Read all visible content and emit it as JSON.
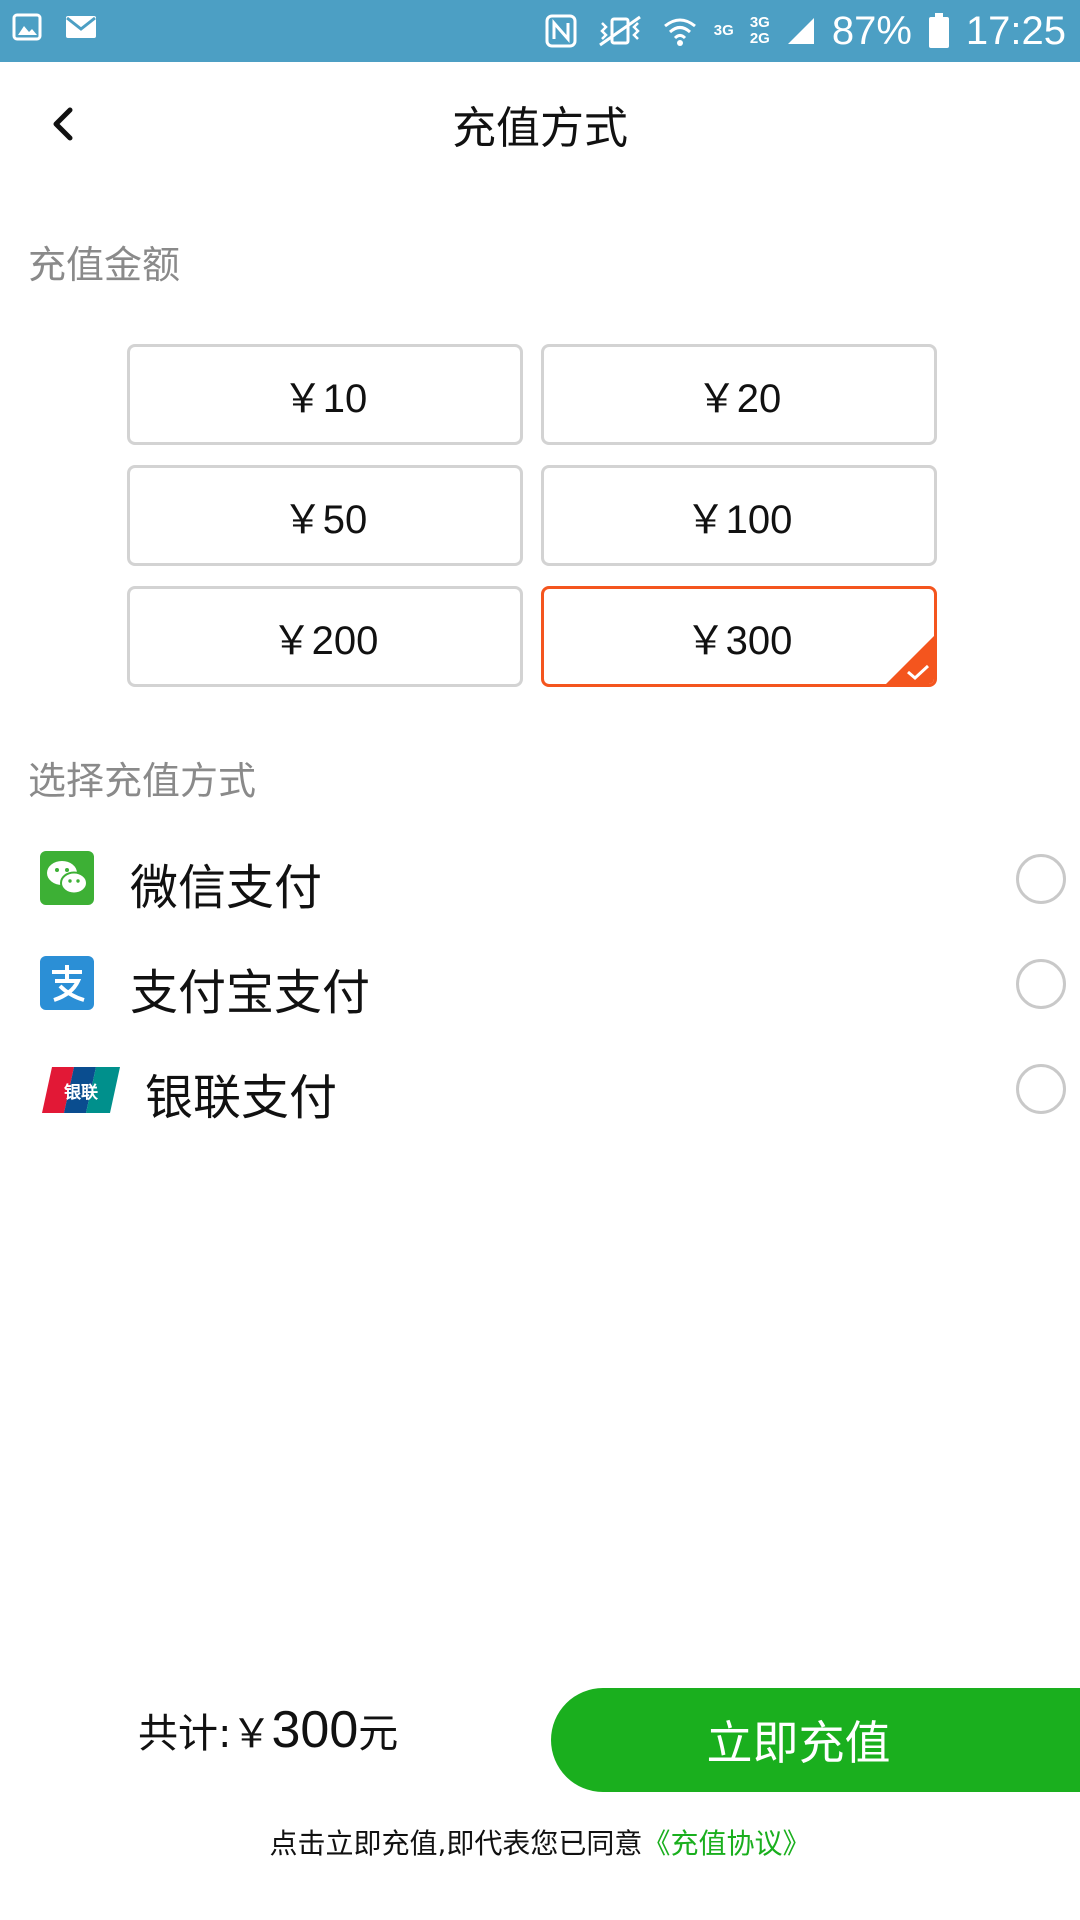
{
  "status_bar": {
    "battery": "87%",
    "time": "17:25",
    "net1": "3G",
    "net2_top": "3G",
    "net2_bottom": "2G",
    "colors": {
      "background": "#4c9fc4"
    }
  },
  "header": {
    "title": "充值方式",
    "back_icon": "chevron-left-icon"
  },
  "amount_section": {
    "label": "充值金额",
    "options": [
      "￥10",
      "￥20",
      "￥50",
      "￥100",
      "￥200",
      "￥300"
    ],
    "selected": "￥300",
    "colors": {
      "selected_border": "#f4551e",
      "border": "#d3d3d3"
    }
  },
  "method_section": {
    "label": "选择充值方式",
    "methods": [
      {
        "label": "微信支付",
        "icon": "wechat-icon"
      },
      {
        "label": "支付宝支付",
        "icon": "alipay-icon"
      },
      {
        "label": "银联支付",
        "icon": "unionpay-icon",
        "icon_text": "银联"
      }
    ]
  },
  "footer": {
    "total_prefix": "共计:￥",
    "total_amount": "300",
    "total_unit": "元",
    "recharge_button": "立即充值",
    "agreement_text": "点击立即充值,即代表您已同意",
    "agreement_link": "《充值协议》",
    "colors": {
      "accent": "#1aaf1e"
    }
  }
}
